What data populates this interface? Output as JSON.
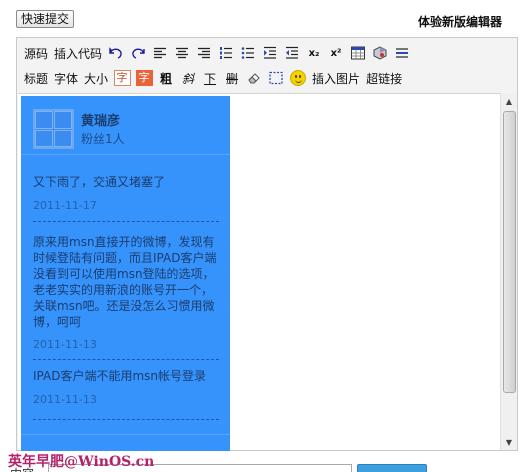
{
  "quick_submit_label": "快速提交",
  "new_editor_label": "体验新版编辑器",
  "toolbar": {
    "row1": {
      "source": "源码",
      "insert_code": "插入代码",
      "undo_icon": "undo-icon",
      "redo_icon": "redo-icon",
      "align_left_icon": "align-left-icon",
      "align_center_icon": "align-center-icon",
      "align_right_icon": "align-right-icon",
      "ordered_list_icon": "ordered-list-icon",
      "unordered_list_icon": "unordered-list-icon",
      "indent_icon": "indent-icon",
      "outdent_icon": "outdent-icon",
      "subscript": "x₂",
      "superscript": "x²",
      "table_icon": "table-icon",
      "flash_icon": "flash-icon",
      "hr_icon": "horizontal-rule-icon"
    },
    "row2": {
      "heading": "标题",
      "font": "字体",
      "size": "大小",
      "font_color": "字",
      "bg_color": "字",
      "bold": "粗",
      "italic": "斜",
      "underline": "下",
      "strike": "删",
      "eraser_icon": "eraser-icon",
      "select_all_icon": "select-all-icon",
      "emoticon_icon": "smiley-icon",
      "insert_image": "插入图片",
      "hyperlink": "超链接"
    }
  },
  "weibo": {
    "user_name": "黄瑞彦",
    "fans": "粉丝1人",
    "posts": [
      {
        "text": "又下雨了，交通又堵塞了",
        "date": "2011-11-17"
      },
      {
        "text": "原来用msn直接开的微博，发现有时候登陆有问题，而且IPAD客户端没看到可以使用msn登陆的选项，老老实实的用新浪的账号开一个，关联msn吧。还是没怎么习惯用微博，呵呵",
        "date": "2011-11-13"
      },
      {
        "text": "IPAD客户端不能用msn帐号登录",
        "date": "2011-11-13"
      }
    ]
  },
  "watermark": "英年早肥@WinOS.cn",
  "bottom_label": "内容",
  "colors": {
    "weibo_bg": "#3793fc",
    "accent_button": "#3aa0e0",
    "watermark": "#b3226a"
  }
}
